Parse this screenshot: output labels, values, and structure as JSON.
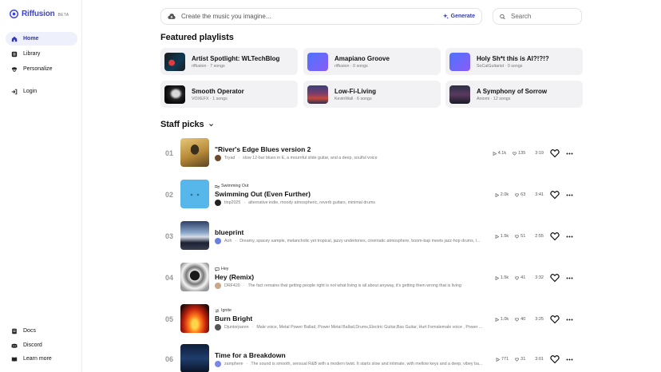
{
  "app": {
    "name": "Riffusion",
    "badge": "BETA"
  },
  "sidebar": {
    "items": [
      {
        "label": "Home",
        "icon": "home-icon",
        "active": true
      },
      {
        "label": "Library",
        "icon": "library-icon"
      },
      {
        "label": "Personalize",
        "icon": "personalize-icon"
      },
      {
        "label": "Login",
        "icon": "login-icon"
      }
    ],
    "bottom": [
      {
        "label": "Docs",
        "icon": "docs-icon"
      },
      {
        "label": "Discord",
        "icon": "discord-icon"
      },
      {
        "label": "Learn more",
        "icon": "learn-more-icon"
      }
    ]
  },
  "topbar": {
    "create_placeholder": "Create the music you imagine...",
    "generate_label": "Generate",
    "search_placeholder": "Search"
  },
  "featured": {
    "heading": "Featured playlists",
    "playlists": [
      {
        "name": "Artist Spotlight: WLTechBlog",
        "sub": "riffusion · 7 songs"
      },
      {
        "name": "Amapiano Groove",
        "sub": "riffusion · 0 songs"
      },
      {
        "name": "Holy Sh*t this is AI?!?!?",
        "sub": "SoCalGuitarist · 0 songs"
      },
      {
        "name": "Smooth Operator",
        "sub": "VOXEFX · 1 songs"
      },
      {
        "name": "Low-Fi-Living",
        "sub": "KevinWall · 6 songs"
      },
      {
        "name": "A Symphony of Sorrow",
        "sub": "Aniomi · 12 songs"
      }
    ]
  },
  "staff": {
    "heading": "Staff picks",
    "tracks": [
      {
        "rank": "01",
        "source": "",
        "title": "\"River's Edge Blues version 2",
        "user": "Tryad",
        "desc": "slow 12-bar blues in E, a mournful slide guitar, and a deep, soulful voice",
        "plays": "4.1k",
        "likes": "135",
        "duration": "3:19"
      },
      {
        "rank": "02",
        "source": "Swimming Out",
        "title": "Swimming Out (Even Further)",
        "user": "tinp2025",
        "desc": "alternative indie, moody atmospheric, reverb guitars, minimal drums",
        "plays": "2.0k",
        "likes": "63",
        "duration": "3:41"
      },
      {
        "rank": "03",
        "source": "",
        "title": "blueprint",
        "user": "Aoh",
        "desc": "Dreamy, spacey sample, melancholic yet tropical, jazzy undertones, cinematic atmosphere, boom-bap meets jazz-hop drums, l...",
        "plays": "1.5k",
        "likes": "51",
        "duration": "2:55"
      },
      {
        "rank": "04",
        "source": "Hey",
        "title": "Hey (Remix)",
        "user": "DRF420",
        "desc": "The fact remains that getting people right is not what living is all about anyway, it's getting them wrong that is living",
        "plays": "1.5k",
        "likes": "41",
        "duration": "3:32"
      },
      {
        "rank": "05",
        "source": "Ignite",
        "title": "Burn Bright",
        "user": "Djuntorparen",
        "desc": "Male voice, Metal Power Ballad, Power Metal Ballad,Drums,Electric Guitar,Bas Guitar, Hurt Femalemale voice , Power ...",
        "plays": "1.0k",
        "likes": "40",
        "duration": "3:25"
      },
      {
        "rank": "06",
        "source": "",
        "title": "Time for a Breakdown",
        "user": "zamphere",
        "desc": "The sound is smooth, sensual R&B with a modern twist. It starts slow and intimate, with mellow keys and a deep, vibey ba...",
        "plays": "771",
        "likes": "31",
        "duration": "3:01"
      }
    ]
  },
  "colors": {
    "accent": "#2f38d1",
    "active_bg": "#eef0fb",
    "card_bg": "#f2f2f5"
  }
}
